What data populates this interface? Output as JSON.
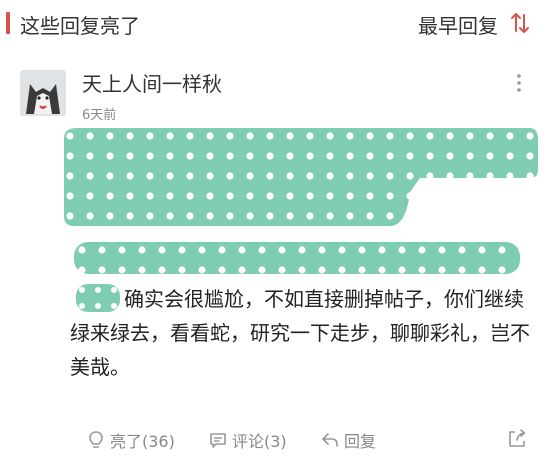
{
  "header": {
    "title": "这些回复亮了",
    "sort_label": "最早回复",
    "accent_color": "#d9534f"
  },
  "comment": {
    "username": "天上人间一样秋",
    "time": "6天前",
    "body": "确实会很尴尬，不如直接删掉帖子，你们继续绿来绿去，看看蛇，研究一下走步，聊聊彩礼，岂不美哉。",
    "redaction_color": "#7ecdb3",
    "actions": {
      "like_label": "亮了(36)",
      "comment_label": "评论(3)",
      "reply_label": "回复"
    }
  }
}
